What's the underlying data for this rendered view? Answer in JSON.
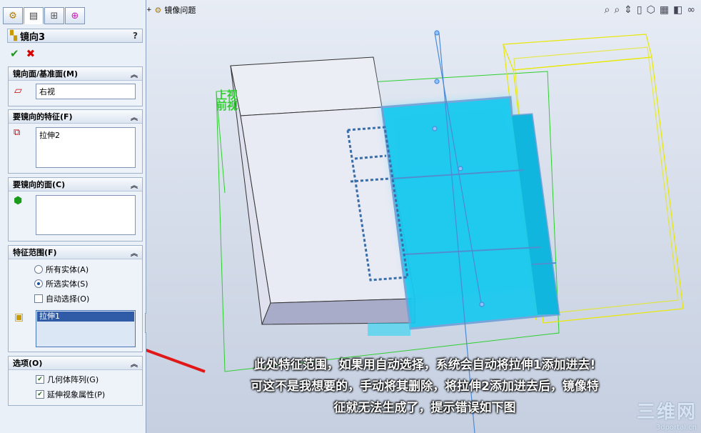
{
  "feature_name": "镜向3",
  "help_label": "?",
  "viewport": {
    "tree_item": "镜像问题",
    "view_labels": [
      "上视",
      "前视"
    ]
  },
  "groups": {
    "mirror_plane": {
      "title": "镜向面/基准面(M)",
      "value": "右视"
    },
    "features": {
      "title": "要镜向的特征(F)",
      "items": [
        "拉伸2"
      ]
    },
    "faces": {
      "title": "要镜向的面(C)"
    },
    "scope": {
      "title": "特征范围(F)",
      "options": [
        "所有实体(A)",
        "所选实体(S)"
      ],
      "selected_option": "所选实体(S)",
      "auto_select_label": "自动选择(O)",
      "auto_select_checked": false,
      "bodies": [
        "拉伸1"
      ]
    },
    "options": {
      "title": "选项(O)",
      "geometry_pattern_label": "几何体阵列(G)",
      "geometry_pattern_checked": true,
      "propagate_label": "延伸视象属性(P)",
      "propagate_checked": true
    }
  },
  "annotation": {
    "lines": [
      "此处特征范围，如果用自动选择，系统会自动将拉伸1添加进去!",
      "可这不是我想要的，手动将其删除，将拉伸2添加进去后，镜像特",
      "征就无法生成了，提示错误如下图"
    ]
  },
  "watermark": {
    "big": "三维网",
    "small": "3dportal.cn"
  },
  "colors": {
    "highlight_body": "#1ed6f5",
    "selection_box": "#2ecf2e",
    "preview_box": "#e8e800",
    "arrow": "#e01818",
    "panel_bg": "#eaf0f8"
  }
}
